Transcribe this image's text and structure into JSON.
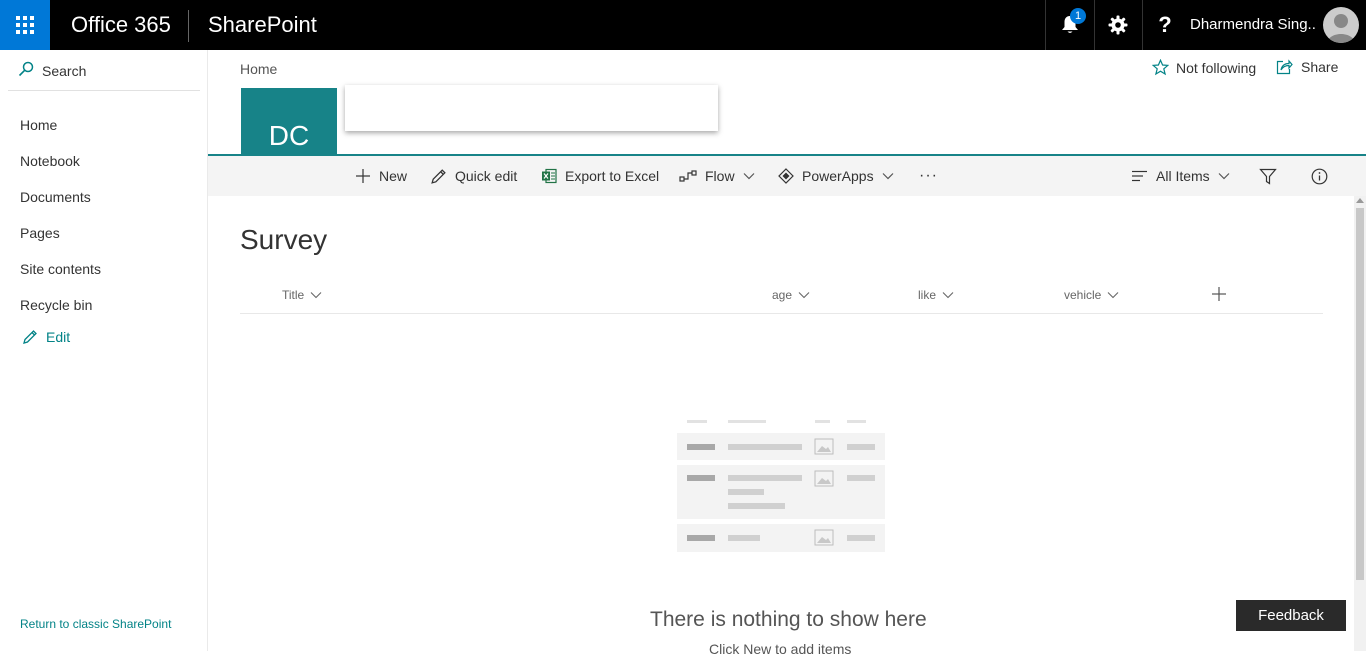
{
  "suite": {
    "brand": "Office 365",
    "app": "SharePoint",
    "notification_count": "1",
    "help_label": "?",
    "user_name": "Dharmendra Sing..."
  },
  "nav": {
    "search_label": "Search",
    "items": [
      "Home",
      "Notebook",
      "Documents",
      "Pages",
      "Site contents",
      "Recycle bin"
    ],
    "edit_label": "Edit",
    "classic_link": "Return to classic SharePoint"
  },
  "site": {
    "breadcrumb": "Home",
    "logo_initials": "DC",
    "follow_label": "Not following",
    "share_label": "Share",
    "accent_color": "#178388"
  },
  "commands": {
    "new": "New",
    "quick_edit": "Quick edit",
    "export": "Export to Excel",
    "flow": "Flow",
    "powerapps": "PowerApps",
    "more": "···",
    "view": "All Items"
  },
  "list": {
    "title": "Survey",
    "columns": [
      "Title",
      "age",
      "like",
      "vehicle"
    ],
    "empty_title": "There is nothing to show here",
    "empty_subtitle": "Click New to add items"
  },
  "feedback_label": "Feedback"
}
